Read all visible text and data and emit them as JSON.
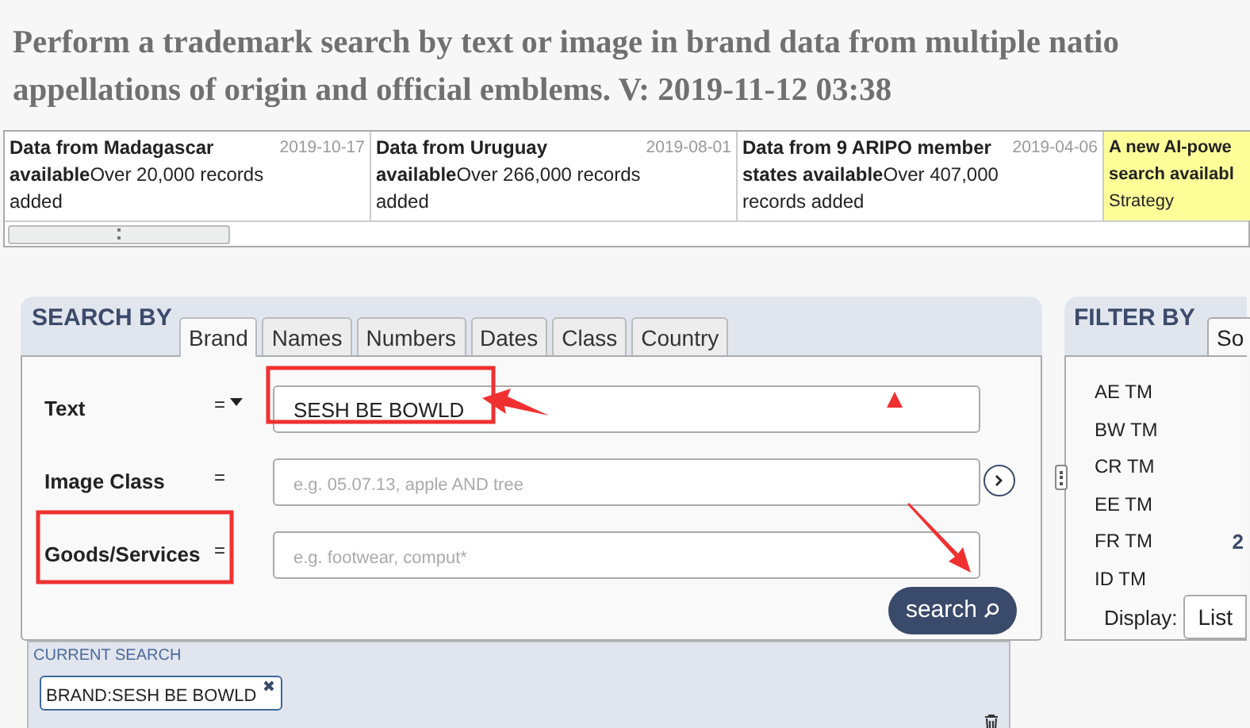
{
  "title_lines": [
    "Perform a trademark search by text or image in brand data from multiple natio",
    "appellations of origin and official emblems. V: 2019-11-12 03:38"
  ],
  "news": [
    {
      "title": "Data from Madagascar available",
      "date": "2019-10-17",
      "body": "Over 20,000 records added",
      "highlighted": false
    },
    {
      "title": "Data from Uruguay available",
      "date": "2019-08-01",
      "body": "Over 266,000 records added",
      "highlighted": false
    },
    {
      "title": "Data from 9 ARIPO member states available",
      "date": "2019-04-06",
      "body": "Over 407,000 records added",
      "highlighted": false
    },
    {
      "title": "A new AI-powe search availabl",
      "body": "Strategy",
      "highlighted": true
    }
  ],
  "search_panel": {
    "heading": "SEARCH BY",
    "tabs": [
      {
        "label": "Brand",
        "selected": true
      },
      {
        "label": "Names",
        "selected": false
      },
      {
        "label": "Numbers",
        "selected": false
      },
      {
        "label": "Dates",
        "selected": false
      },
      {
        "label": "Class",
        "selected": false
      },
      {
        "label": "Country",
        "selected": false
      }
    ],
    "fields": [
      {
        "label": "Text",
        "operator": "=",
        "has_dropdown": true,
        "value": "SESH BE BOWLD"
      },
      {
        "label": "Image Class",
        "operator": "=",
        "has_dropdown": false,
        "placeholder": "e.g. 05.07.13, apple AND tree"
      },
      {
        "label": "Goods/Services",
        "operator": "=",
        "has_dropdown": false,
        "placeholder": "e.g. footwear, comput*"
      }
    ],
    "search_button": "search"
  },
  "current_search": {
    "heading": "CURRENT SEARCH",
    "tags": [
      "BRAND:SESH BE BOWLD"
    ]
  },
  "filter_panel": {
    "heading": "FILTER BY",
    "tab": "So",
    "items": [
      {
        "label": "AE TM"
      },
      {
        "label": "BW TM"
      },
      {
        "label": "CR TM"
      },
      {
        "label": "EE TM"
      },
      {
        "label": "FR TM",
        "count": "2"
      },
      {
        "label": "ID TM"
      }
    ],
    "display_label": "Display:",
    "display_value": "List"
  }
}
